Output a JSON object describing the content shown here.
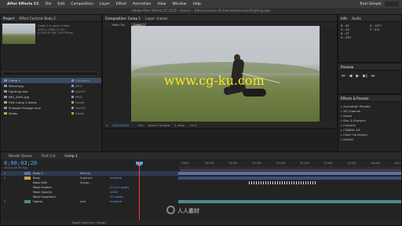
{
  "menubar": {
    "app_name": "After Effects CC",
    "items": [
      "File",
      "Edit",
      "Composition",
      "Layer",
      "Effect",
      "Animation",
      "View",
      "Window",
      "Help"
    ],
    "workspace": "Train Simple"
  },
  "titlebar": {
    "text": "Adobe After Effects CC 2015 - /Users/... Effects/Lesson 06 Elements/Lesson/Fighting.aep"
  },
  "project": {
    "tabs": [
      "Project",
      "Effect Controls Body 2"
    ],
    "thumb_info": [
      "Comp 1 ▾, used 1 time",
      "1920 x 1080 (1.00)",
      "Δ 0;00;07;00, 23.976 fps"
    ],
    "rows": [
      {
        "name": "Comp 1",
        "type": "Composit",
        "icon": "comp",
        "swatch": "#8c7ec8",
        "selected": true
      },
      {
        "name": "Wheel.jpg",
        "type": "JPEG",
        "icon": "foot",
        "swatch": "#7d9bb5",
        "selected": false
      },
      {
        "name": "Fighting.mov",
        "type": "QuickT",
        "icon": "foot",
        "swatch": "#7d9bb5",
        "selected": false
      },
      {
        "name": "IMG_4591.jpg",
        "type": "JPEG",
        "icon": "foot",
        "swatch": "#7d9bb5",
        "selected": false
      },
      {
        "name": "Fitle Comp 2 items",
        "type": "Folder",
        "icon": "folder",
        "swatch": "#c9a23a",
        "selected": false
      },
      {
        "name": "Shadow Footage.mov",
        "type": "QuickT",
        "icon": "foot",
        "swatch": "#7d9bb5",
        "selected": false
      },
      {
        "name": "Solids",
        "type": "Folder",
        "icon": "folder",
        "swatch": "#c9a23a",
        "selected": false
      }
    ],
    "bottom": [
      "8 bpc"
    ]
  },
  "composition": {
    "tabs": [
      "Composition: Comp 1",
      "Layer: (none)"
    ],
    "subtabs": [
      "Fitst Cut",
      "Comp 1"
    ],
    "watermark": "www.cg-ku.com",
    "controls": [
      "Full",
      "Active Camera",
      "1 View",
      "+0.0"
    ],
    "timecode": "0;00;03;20"
  },
  "info": {
    "tabs": [
      "Info",
      "Audio"
    ],
    "rgb": [
      "R : 45",
      "G : 49",
      "B : 47",
      "A : 255"
    ],
    "xy": [
      "X : 1377",
      "Y : 512"
    ]
  },
  "preview": {
    "tabs": [
      "Preview"
    ],
    "buttons": [
      "⏮",
      "◀",
      "▶",
      "▶|",
      "⏭"
    ]
  },
  "effects": {
    "tabs": [
      "Effects & Presets"
    ],
    "items": [
      "Animation Presets",
      "3D Channel",
      "Audio",
      "Blur & Sharpen",
      "Channel",
      "CINEMA 4D",
      "Color Correction",
      "Distort"
    ]
  },
  "timeline": {
    "tabs": [
      "Render Queue",
      "First Cut",
      "Comp 1"
    ],
    "timecode": "0;00;03;20",
    "framecount": "00110 (29.97 fps)",
    "ruler_ticks": [
      "0:00f",
      "00:15f",
      "01:00f",
      "01:15f",
      "02:00f",
      "02:15f",
      "03:00f",
      "03:15f",
      "04:00f",
      "04:15f"
    ],
    "layers": [
      {
        "num": "1",
        "name": "Body 2",
        "mode": "Normal",
        "value": "",
        "color": "#5b6fa8",
        "selected": true
      },
      {
        "num": "2",
        "name": "Body",
        "mode": "Subtract",
        "value": "Inverted",
        "color": "#c9a23a",
        "selected": false
      },
      {
        "num": "",
        "name": "Mask Path",
        "mode": "Shape...",
        "value": "",
        "color": "",
        "selected": false
      },
      {
        "num": "",
        "name": "Mask Feather",
        "mode": "",
        "value": "0.0,0.0 pixels",
        "color": "",
        "selected": false
      },
      {
        "num": "",
        "name": "Mask Opacity",
        "mode": "",
        "value": "100%",
        "color": "",
        "selected": false
      },
      {
        "num": "",
        "name": "Mask Expansion",
        "mode": "",
        "value": "0.0 pixels",
        "color": "",
        "selected": false
      },
      {
        "num": "3",
        "name": "Fighter",
        "mode": "Add",
        "value": "Inverted",
        "color": "#4a8a8a",
        "selected": false
      }
    ],
    "bottom": "Toggle Switches / Modes"
  },
  "overlay_watermark": "人人素材"
}
